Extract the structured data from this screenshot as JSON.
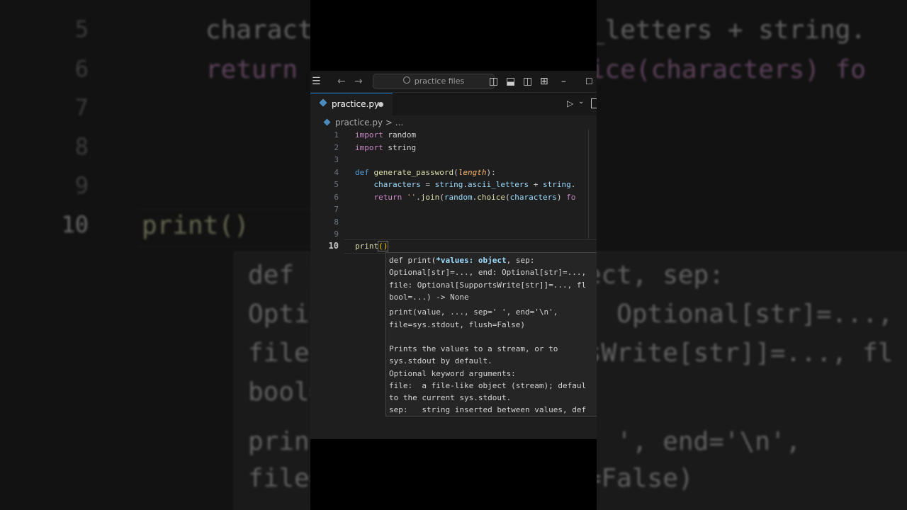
{
  "search": {
    "placeholder": "practice files"
  },
  "tab": {
    "filename": "practice.py"
  },
  "breadcrumb": {
    "file": "practice.py",
    "sep": ">",
    "more": "..."
  },
  "code_lines": [
    {
      "n": "1",
      "text": "import random"
    },
    {
      "n": "2",
      "text": "import string"
    },
    {
      "n": "3",
      "text": ""
    },
    {
      "n": "4",
      "text": "def generate_password(length):"
    },
    {
      "n": "5",
      "text": "    characters = string.ascii_letters + string."
    },
    {
      "n": "6",
      "text": "    return ''.join(random.choice(characters) fo"
    },
    {
      "n": "7",
      "text": ""
    },
    {
      "n": "8",
      "text": ""
    },
    {
      "n": "9",
      "text": ""
    },
    {
      "n": "10",
      "text": "print()"
    }
  ],
  "hover": {
    "sig1": "def print(*values: object, sep:",
    "sig2": "Optional[str]=..., end: Optional[str]=...,",
    "sig3": "file: Optional[SupportsWrite[str]]=..., fl",
    "sig4": "bool=...) -> None",
    "doc1": "print(value, ..., sep=' ', end='\\n',",
    "doc2": "file=sys.stdout, flush=False)",
    "doc3": "Prints the values to a stream, or to",
    "doc4": "sys.stdout by default.",
    "doc5": "Optional keyword arguments:",
    "doc6": "file:  a file-like object (stream); defaul",
    "doc7": "to the current sys.stdout.",
    "doc8": "sep:   string inserted between values, def"
  },
  "background": {
    "left_lines": [
      "5",
      "6",
      "7",
      "8",
      "9",
      "10"
    ],
    "code5": "characters = string.ascii_letters + string.",
    "code6": "return ''.join(random.choice(characters) fo",
    "code10": "print()",
    "h1": "def print(*values: object, sep:",
    "h2": "Optional[str]=..., end: Optional[str]=...,",
    "h3": "file: Optional[SupportsWrite[str]]=..., fl",
    "h4": "bool=...) -> None",
    "h5": "print(value, ..., sep=' ', end='\\n',",
    "h6": "file=sys.stdout, flush=False)"
  }
}
